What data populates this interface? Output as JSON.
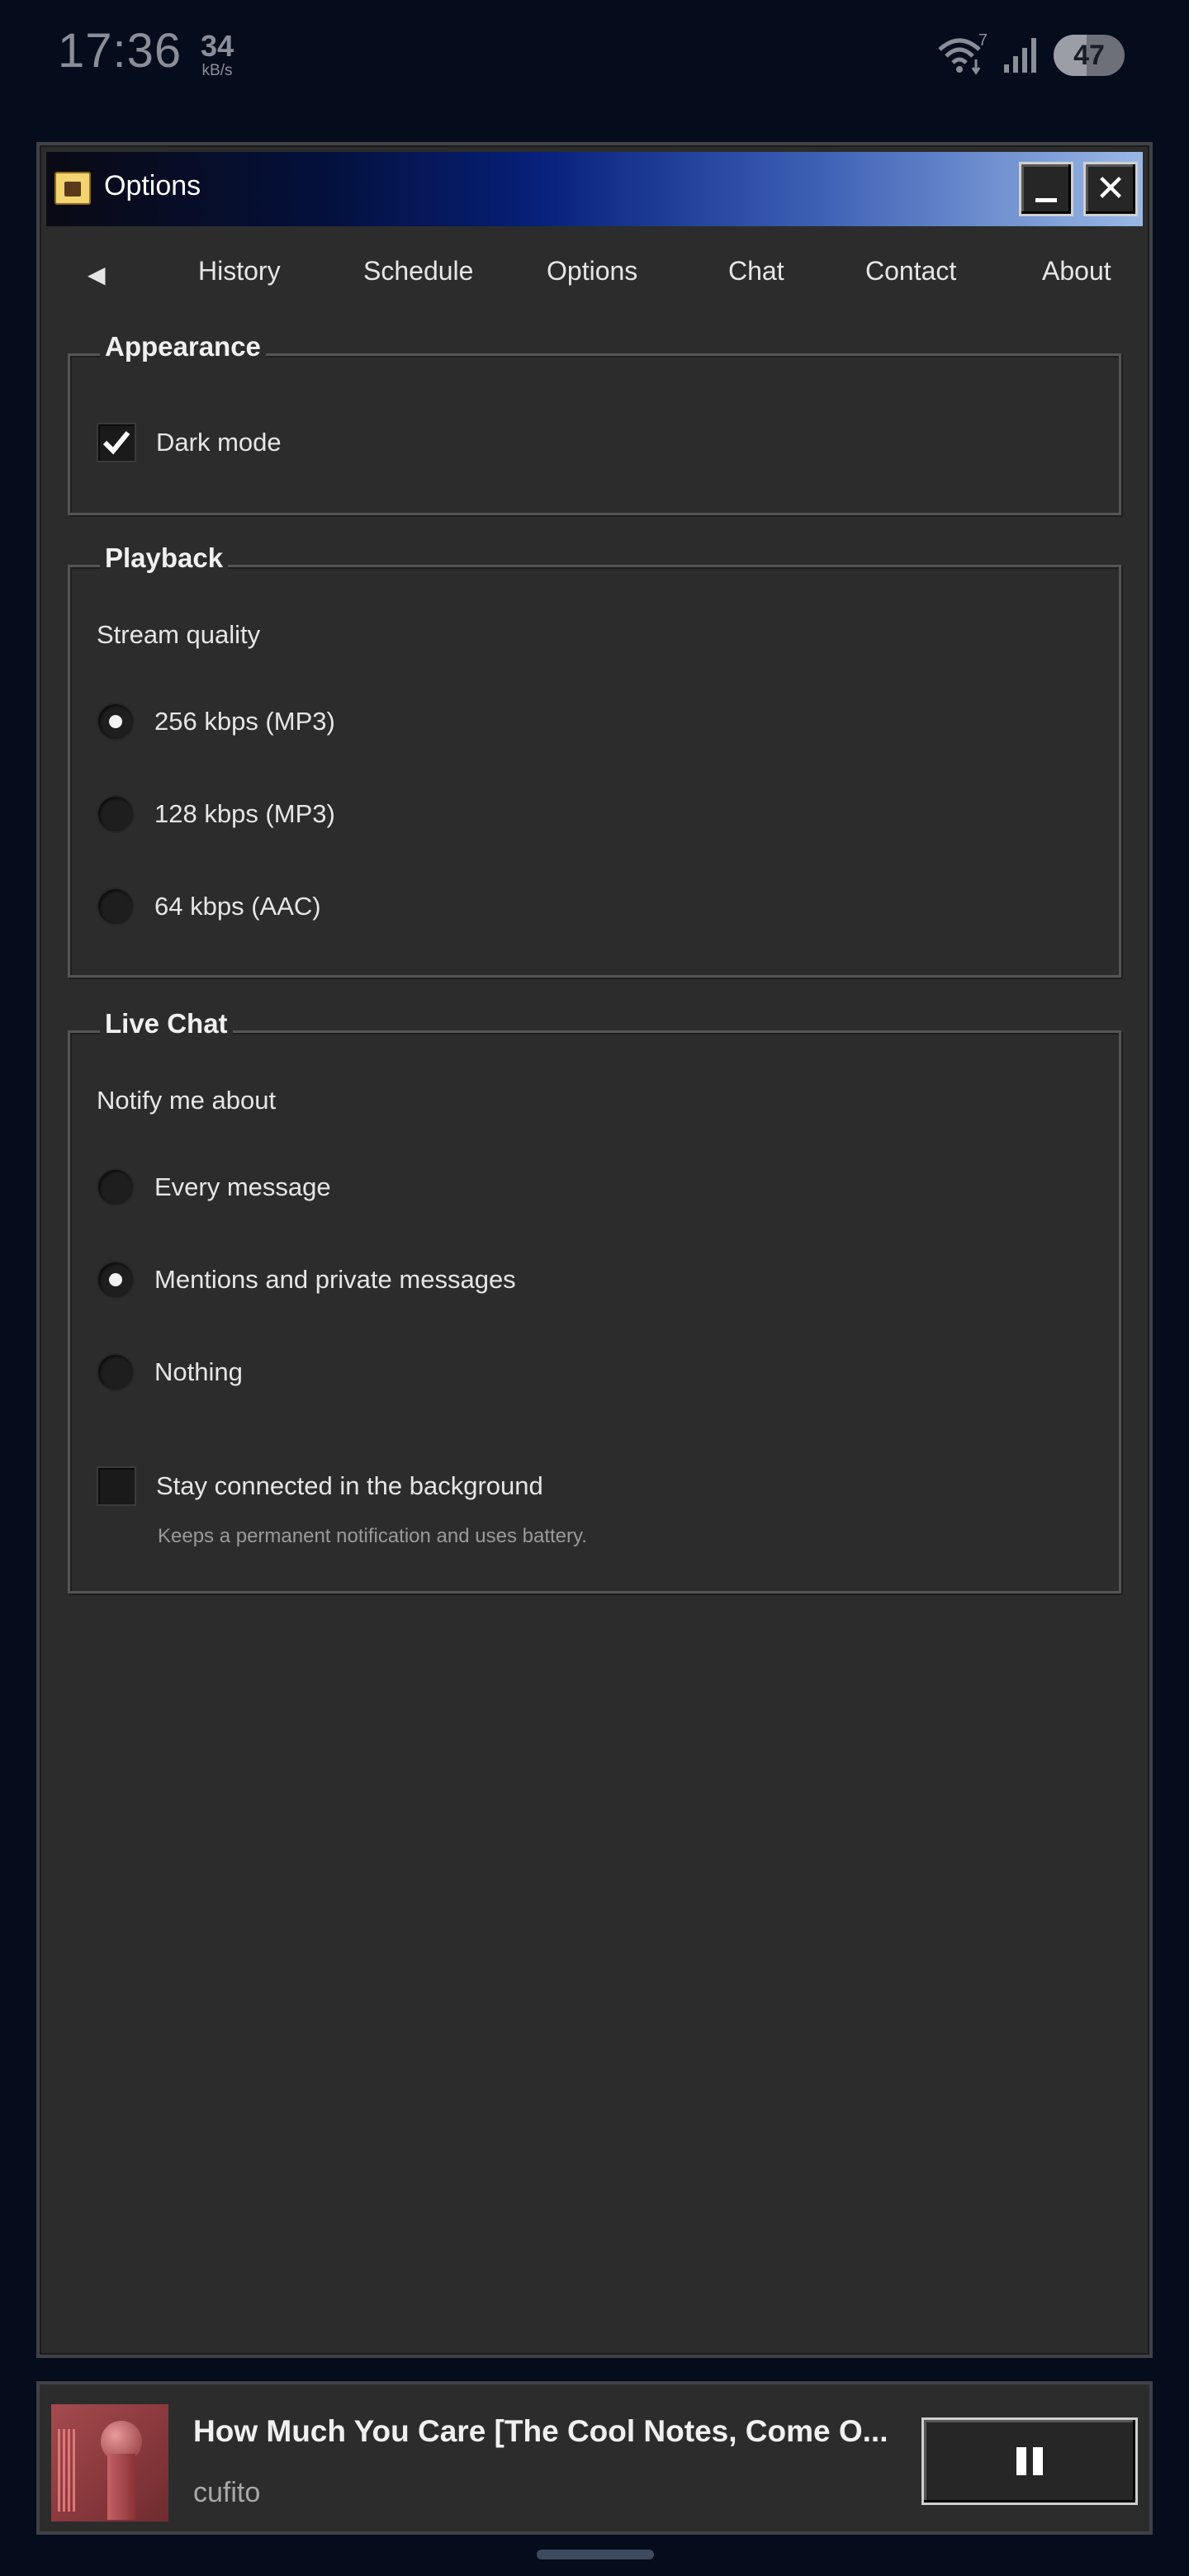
{
  "status_bar": {
    "time": "17:36",
    "net_speed_value": "34",
    "net_speed_unit": "kB/s",
    "wifi_badge": "7",
    "battery": "47",
    "icons": [
      "wifi-icon",
      "signal-icon",
      "battery-icon"
    ]
  },
  "window": {
    "title": "Options",
    "icon": "app-icon",
    "minimize_icon": "minimize-icon",
    "close_icon": "close-icon"
  },
  "tabs": {
    "back": "◀",
    "items": [
      {
        "label": "History"
      },
      {
        "label": "Schedule"
      },
      {
        "label": "Options"
      },
      {
        "label": "Chat"
      },
      {
        "label": "Contact"
      },
      {
        "label": "About"
      }
    ]
  },
  "appearance": {
    "legend": "Appearance",
    "dark_mode_label": "Dark mode",
    "dark_mode_checked": true
  },
  "playback": {
    "legend": "Playback",
    "label": "Stream quality",
    "options": [
      {
        "label": "256 kbps (MP3)",
        "selected": true
      },
      {
        "label": "128 kbps (MP3)",
        "selected": false
      },
      {
        "label": "64 kbps (AAC)",
        "selected": false
      }
    ]
  },
  "live_chat": {
    "legend": "Live Chat",
    "label": "Notify me about",
    "options": [
      {
        "label": "Every message",
        "selected": false
      },
      {
        "label": "Mentions and private messages",
        "selected": true
      },
      {
        "label": "Nothing",
        "selected": false
      }
    ],
    "background_label": "Stay connected in the background",
    "background_checked": false,
    "background_hint": "Keeps a permanent notification and uses battery."
  },
  "player": {
    "title": "How Much You Care [The Cool Notes, Come O...",
    "artist": "cufito",
    "button_icon": "pause-icon"
  },
  "colors": {
    "background": "#050c1c",
    "window": "#2c2c2c",
    "title_gradient_start": "#04103a",
    "title_gradient_end": "#9ab8e6"
  }
}
